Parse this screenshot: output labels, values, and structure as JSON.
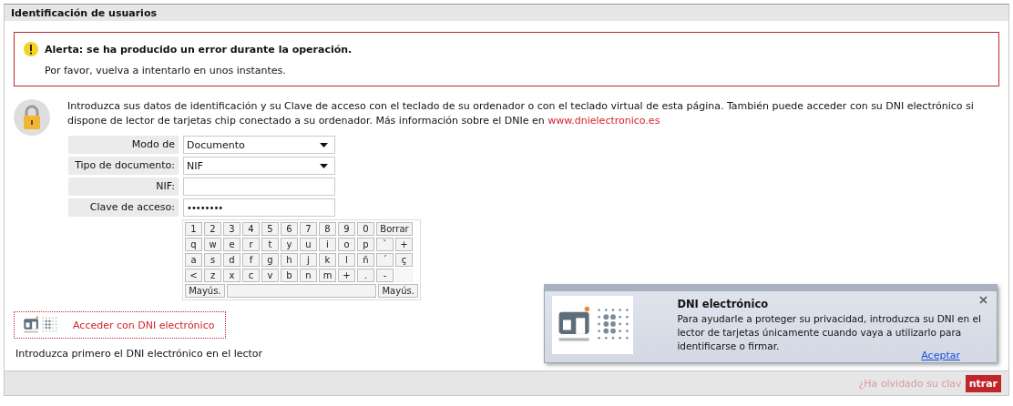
{
  "panel": {
    "title": "Identificación de usuarios"
  },
  "alert": {
    "title": "Alerta: se ha producido un error durante la operación.",
    "message": "Por favor, vuelva a intentarlo en unos instantes."
  },
  "intro": {
    "text": "Introduzca sus datos de identificación y su Clave de acceso con el teclado de su ordenador o con el teclado virtual de esta página. También puede acceder con su DNI electrónico si dispone de lector de tarjetas chip conectado a su ordenador. Más información sobre el DNIe en ",
    "link": "www.dnielectronico.es"
  },
  "form": [
    {
      "label": "Modo de",
      "kind": "select",
      "value": "Documento"
    },
    {
      "label": "Tipo de documento:",
      "kind": "select",
      "value": "NIF"
    },
    {
      "label": "NIF:",
      "kind": "text"
    },
    {
      "label": "Clave de acceso:",
      "kind": "password",
      "value": "••••••••"
    }
  ],
  "keyboard": [
    [
      {
        "label": "1"
      },
      {
        "label": "2"
      },
      {
        "label": "3"
      },
      {
        "label": "4"
      },
      {
        "label": "5"
      },
      {
        "label": "6"
      },
      {
        "label": "7"
      },
      {
        "label": "8"
      },
      {
        "label": "9"
      },
      {
        "label": "0"
      },
      {
        "label": "Borrar",
        "kind": "wide"
      }
    ],
    [
      {
        "label": "q"
      },
      {
        "label": "w"
      },
      {
        "label": "e"
      },
      {
        "label": "r"
      },
      {
        "label": "t"
      },
      {
        "label": "y"
      },
      {
        "label": "u"
      },
      {
        "label": "i"
      },
      {
        "label": "o"
      },
      {
        "label": "p"
      },
      {
        "label": "`"
      },
      {
        "label": "+"
      }
    ],
    [
      {
        "label": "a"
      },
      {
        "label": "s"
      },
      {
        "label": "d"
      },
      {
        "label": "f"
      },
      {
        "label": "g"
      },
      {
        "label": "h"
      },
      {
        "label": "j"
      },
      {
        "label": "k"
      },
      {
        "label": "l"
      },
      {
        "label": "ñ"
      },
      {
        "label": "´"
      },
      {
        "label": "ç"
      }
    ],
    [
      {
        "label": "<"
      },
      {
        "label": "z"
      },
      {
        "label": "x"
      },
      {
        "label": "c"
      },
      {
        "label": "v"
      },
      {
        "label": "b"
      },
      {
        "label": "n"
      },
      {
        "label": "m"
      },
      {
        "label": "+"
      },
      {
        "label": "."
      },
      {
        "label": "-"
      },
      {
        "kind": "blank"
      }
    ],
    [
      {
        "label": "Mayús.",
        "kind": "shift"
      },
      {
        "kind": "space"
      },
      {
        "label": "Mayús.",
        "kind": "shift"
      }
    ]
  ],
  "dni_button": {
    "label": "Acceder con DNI electrónico"
  },
  "dni_hint": "Introduzca primero el DNI electrónico en el lector",
  "footer": {
    "link": "¿Ha olvidado su clav",
    "button": "ntrar"
  },
  "popup": {
    "title": "DNI electrónico",
    "message": "Para ayudarle a proteger su privacidad, introduzca su DNI en el lector de tarjetas únicamente cuando vaya a utilizarlo para identificarse o firmar.",
    "link": "Aceptar"
  }
}
